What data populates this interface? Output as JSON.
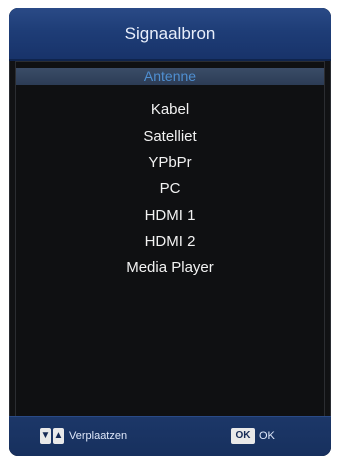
{
  "menu": {
    "title": "Signaalbron",
    "items": [
      {
        "label": "Antenne",
        "selected": true
      },
      {
        "label": "Kabel",
        "selected": false
      },
      {
        "label": "Satelliet",
        "selected": false
      },
      {
        "label": "YPbPr",
        "selected": false
      },
      {
        "label": "PC",
        "selected": false
      },
      {
        "label": "HDMI 1",
        "selected": false
      },
      {
        "label": "HDMI 2",
        "selected": false
      },
      {
        "label": "Media Player",
        "selected": false
      }
    ]
  },
  "footer": {
    "down_key": "▼",
    "up_key": "▲",
    "move_label": "Verplaatzen",
    "ok_key": "OK",
    "ok_label": "OK"
  },
  "colors": {
    "header": "#1e3d77",
    "selected_text": "#4f8fd1",
    "background": "#111214"
  }
}
